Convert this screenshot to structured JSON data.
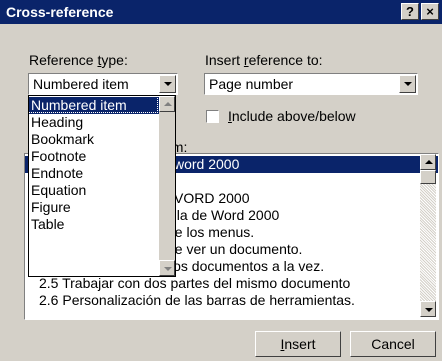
{
  "window": {
    "title": "Cross-reference",
    "help_btn": "?",
    "close_btn": "×"
  },
  "reference_type": {
    "label_pre": "Reference ",
    "label_key": "t",
    "label_post": "ype:",
    "value": "Numbered item",
    "options": [
      "Numbered item",
      "Heading",
      "Bookmark",
      "Footnote",
      "Endnote",
      "Equation",
      "Figure",
      "Table"
    ]
  },
  "insert_reference": {
    "label_pre": "Insert ",
    "label_key": "r",
    "label_post": "eference to:",
    "value": "Page number"
  },
  "include_checkbox": {
    "label_pre": "",
    "label_key": "I",
    "label_post": "nclude above/below"
  },
  "for_which": {
    "label_tail": "em:",
    "items_visible": [
      "word 2000",
      "",
      "VORD 2000",
      "talla de Word 2000",
      "de los menus.",
      "de ver un documento.",
      "ios documentos a la vez.",
      "2.5 Trabajar con dos partes del mismo documento",
      "2.6 Personalización de las barras de herramientas."
    ]
  },
  "buttons": {
    "insert_key": "I",
    "insert_rest": "nsert",
    "cancel": "Cancel"
  }
}
